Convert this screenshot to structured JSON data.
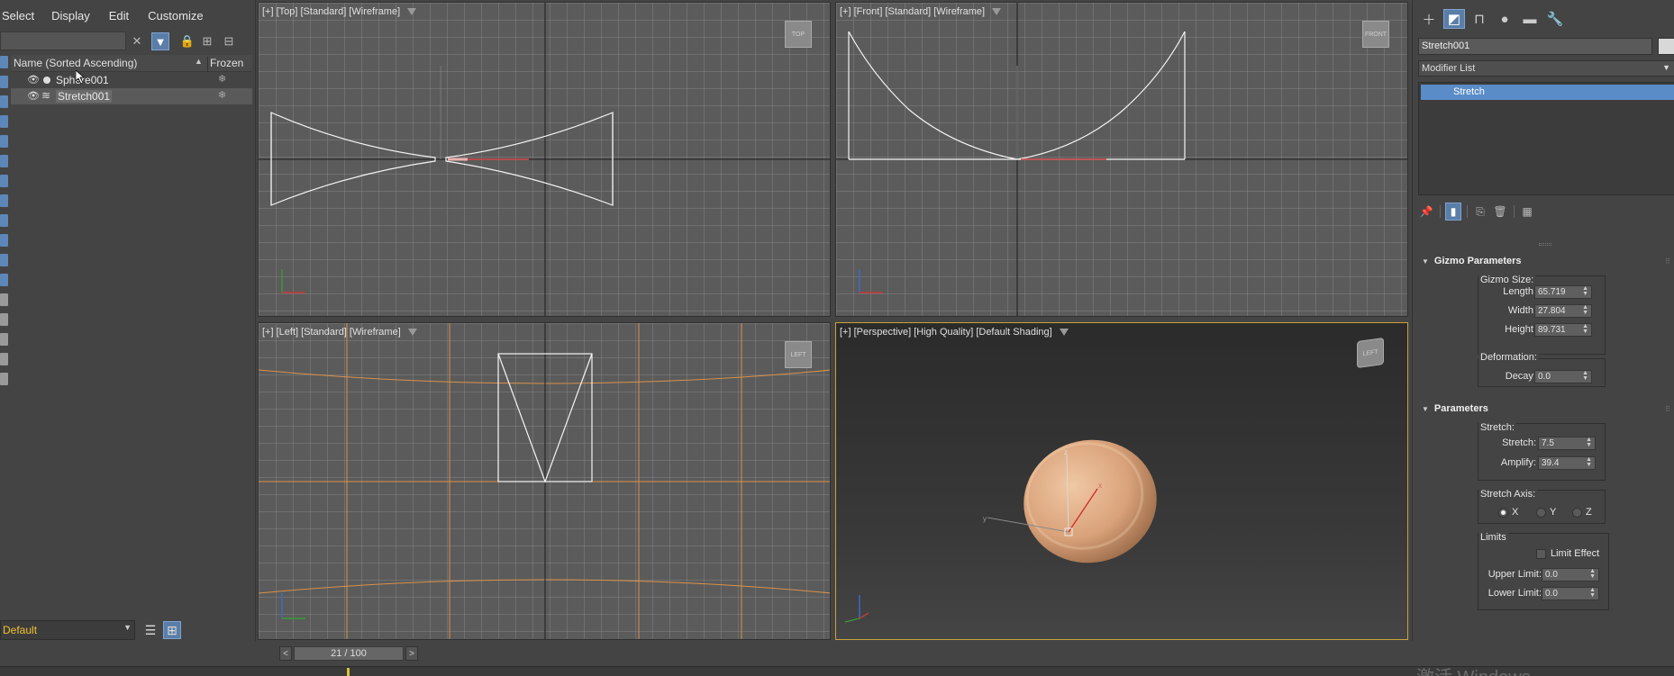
{
  "menu": [
    "Select",
    "Display",
    "Edit",
    "Customize"
  ],
  "explorer": {
    "search_placeholder": "",
    "columns": {
      "name": "Name (Sorted Ascending)",
      "sort_indicator": "▲",
      "frozen": "Frozen"
    },
    "rows": [
      {
        "label": "Sphere001",
        "selected": false
      },
      {
        "label": "Stretch001",
        "selected": true
      }
    ],
    "layer": "Default"
  },
  "viewports": {
    "top": "[+] [Top] [Standard] [Wireframe]",
    "front": "[+] [Front] [Standard] [Wireframe]",
    "left": "[+] [Left] [Standard] [Wireframe]",
    "perspective": "[+] [Perspective] [High Quality] [Default Shading]",
    "cubes": {
      "top": "TOP",
      "front": "FRONT",
      "left": "LEFT",
      "persp": "LEFT"
    }
  },
  "timeline": {
    "frame": "21 / 100",
    "prev": "<",
    "next": ">"
  },
  "watermark": "激活 Windows",
  "command_panel": {
    "object_name": "Stretch001",
    "modifier_list": "Modifier List",
    "stack": [
      "Stretch"
    ],
    "gizmo": {
      "title": "Gizmo Parameters",
      "size_label": "Gizmo Size:",
      "length_label": "Length:",
      "length": "65.719",
      "width_label": "Width:",
      "width": "27.804",
      "height_label": "Height:",
      "height": "89.731",
      "deformation_label": "Deformation:",
      "decay_label": "Decay:",
      "decay": "0.0"
    },
    "parameters": {
      "title": "Parameters",
      "stretch_group": "Stretch:",
      "stretch_label": "Stretch:",
      "stretch": "7.5",
      "amplify_label": "Amplify:",
      "amplify": "39.4",
      "axis_group": "Stretch Axis:",
      "axes": [
        "X",
        "Y",
        "Z"
      ],
      "axis_selected": "X",
      "limits_group": "Limits",
      "limit_effect": "Limit Effect",
      "upper_label": "Upper Limit:",
      "upper": "0.0",
      "lower_label": "Lower Limit:",
      "lower": "0.0"
    }
  },
  "colors": {
    "accent": "#5a8cc8",
    "selection_frame": "#c9a23c",
    "layer_text": "#f0c030",
    "mesh": "#d9a884"
  }
}
